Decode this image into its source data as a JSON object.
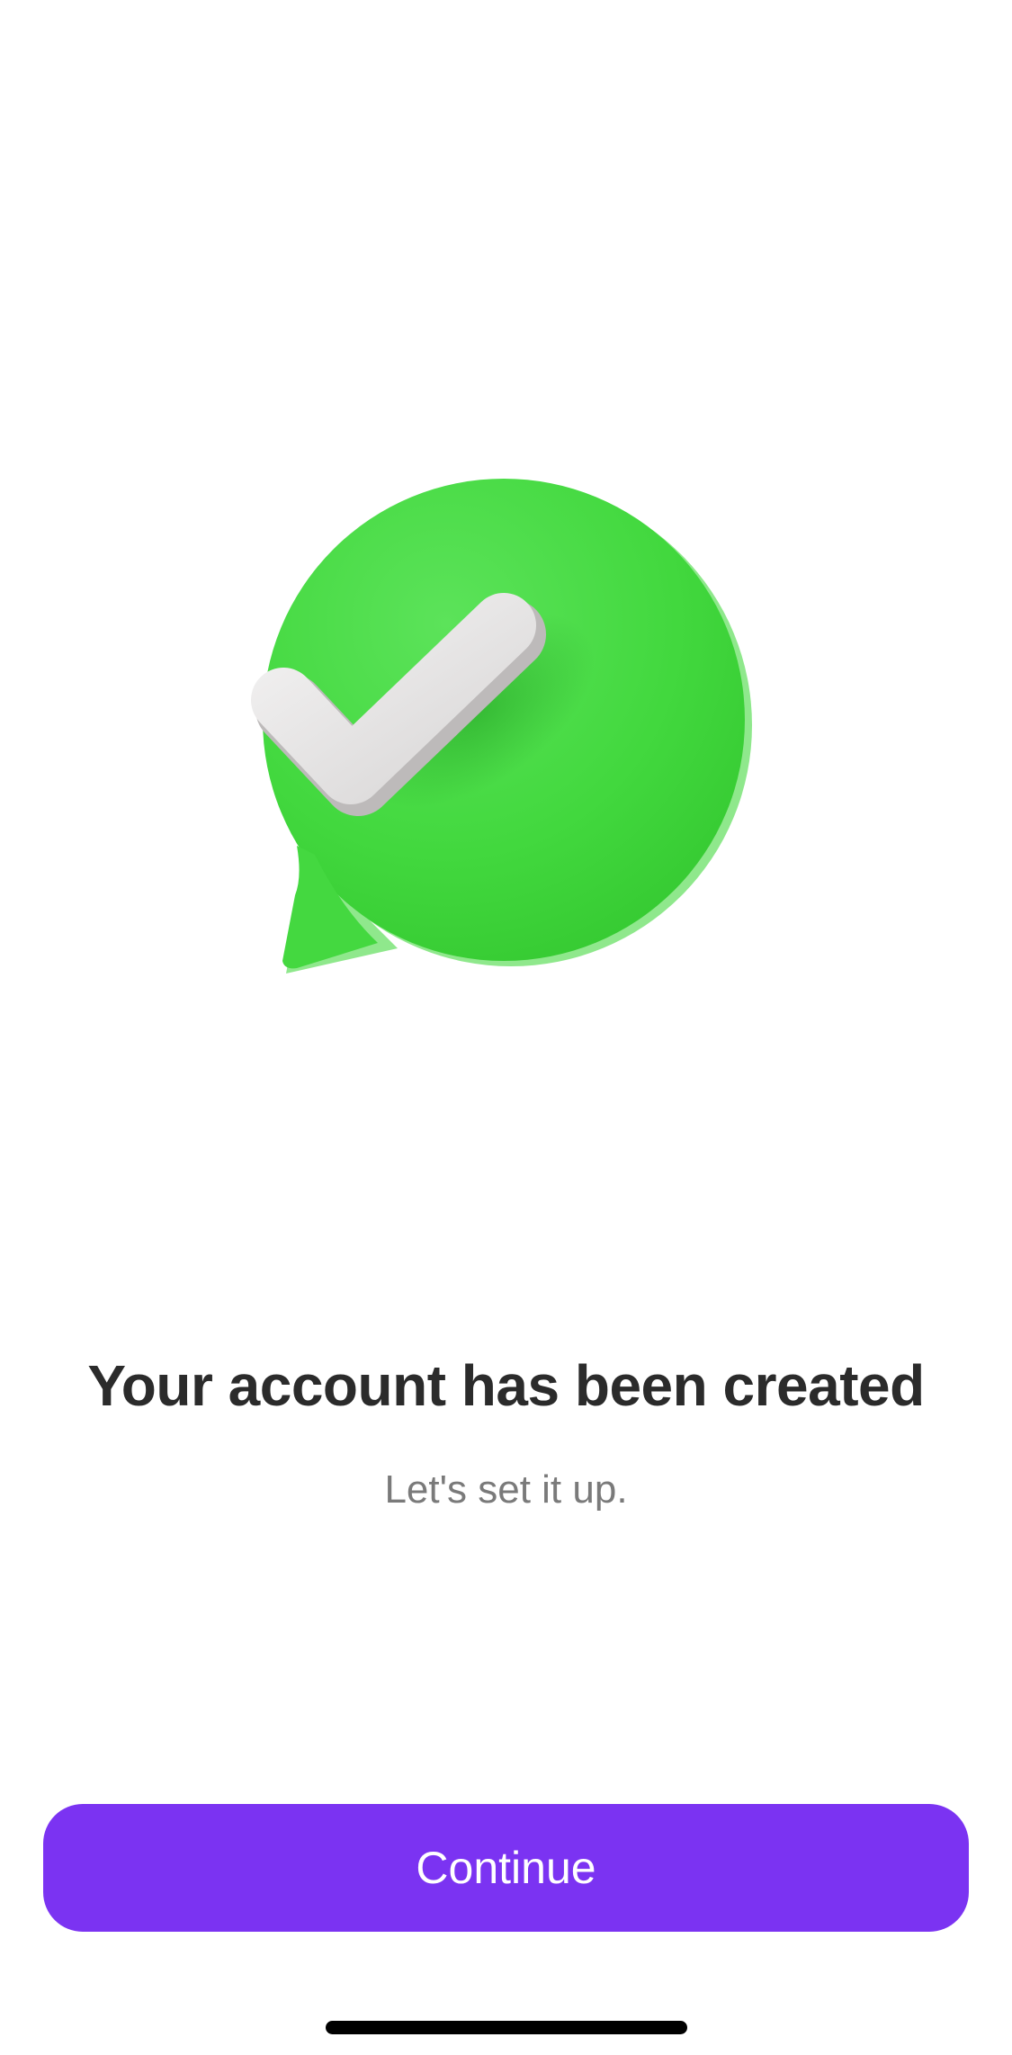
{
  "illustration": {
    "icon": "chat-bubble-checkmark-icon",
    "bubble_color": "#3fd43f",
    "check_color": "#e6e4e4"
  },
  "content": {
    "title": "Your account has been created",
    "subtitle": "Let's set it up."
  },
  "actions": {
    "continue_label": "Continue",
    "button_color": "#7b33f2"
  }
}
